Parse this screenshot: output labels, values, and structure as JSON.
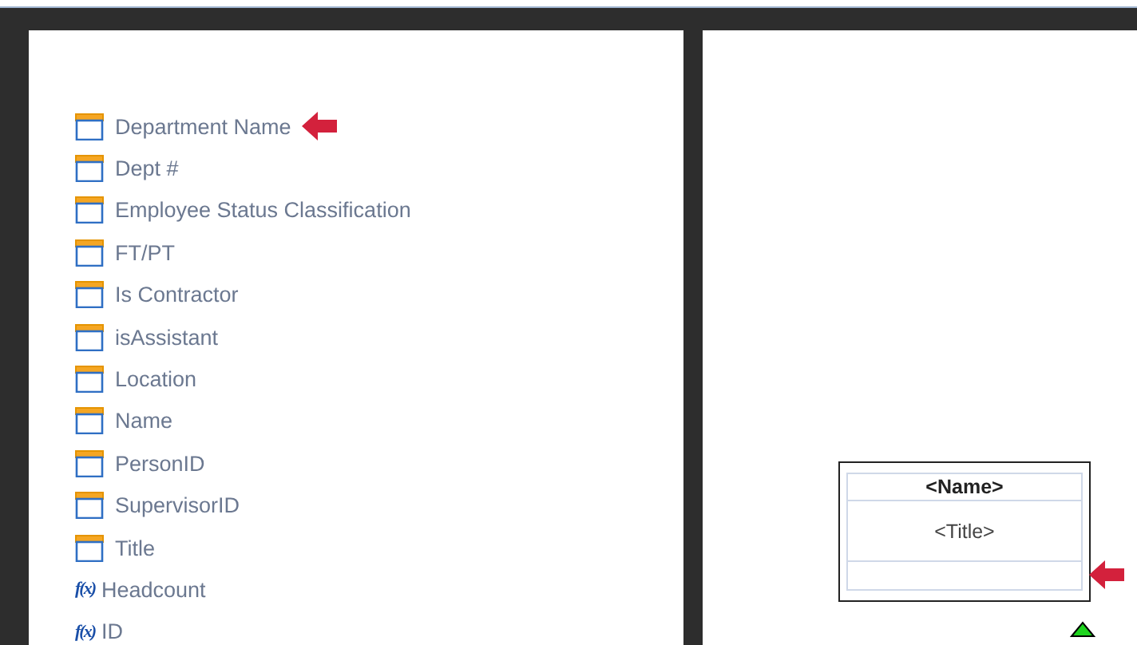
{
  "fields": [
    {
      "label": "Department Name",
      "kind": "field",
      "pointer": true
    },
    {
      "label": "Dept #",
      "kind": "field",
      "pointer": false
    },
    {
      "label": "Employee Status Classification",
      "kind": "field",
      "pointer": false
    },
    {
      "label": "FT/PT",
      "kind": "field",
      "pointer": false
    },
    {
      "label": "Is Contractor",
      "kind": "field",
      "pointer": false
    },
    {
      "label": "isAssistant",
      "kind": "field",
      "pointer": false
    },
    {
      "label": "Location",
      "kind": "field",
      "pointer": false
    },
    {
      "label": "Name",
      "kind": "field",
      "pointer": false
    },
    {
      "label": "PersonID",
      "kind": "field",
      "pointer": false
    },
    {
      "label": "SupervisorID",
      "kind": "field",
      "pointer": false
    },
    {
      "label": "Title",
      "kind": "field",
      "pointer": false
    },
    {
      "label": "Headcount",
      "kind": "formula",
      "icon": "f(x)",
      "pointer": false
    },
    {
      "label": "ID",
      "kind": "formula",
      "icon": "f(x)",
      "pointer": false
    }
  ],
  "card": {
    "rows": [
      {
        "text": "<Name>",
        "kind": "header",
        "pointer": false
      },
      {
        "text": "<Title>",
        "kind": "body",
        "pointer": false
      },
      {
        "text": "",
        "kind": "empty",
        "pointer": true
      }
    ]
  }
}
